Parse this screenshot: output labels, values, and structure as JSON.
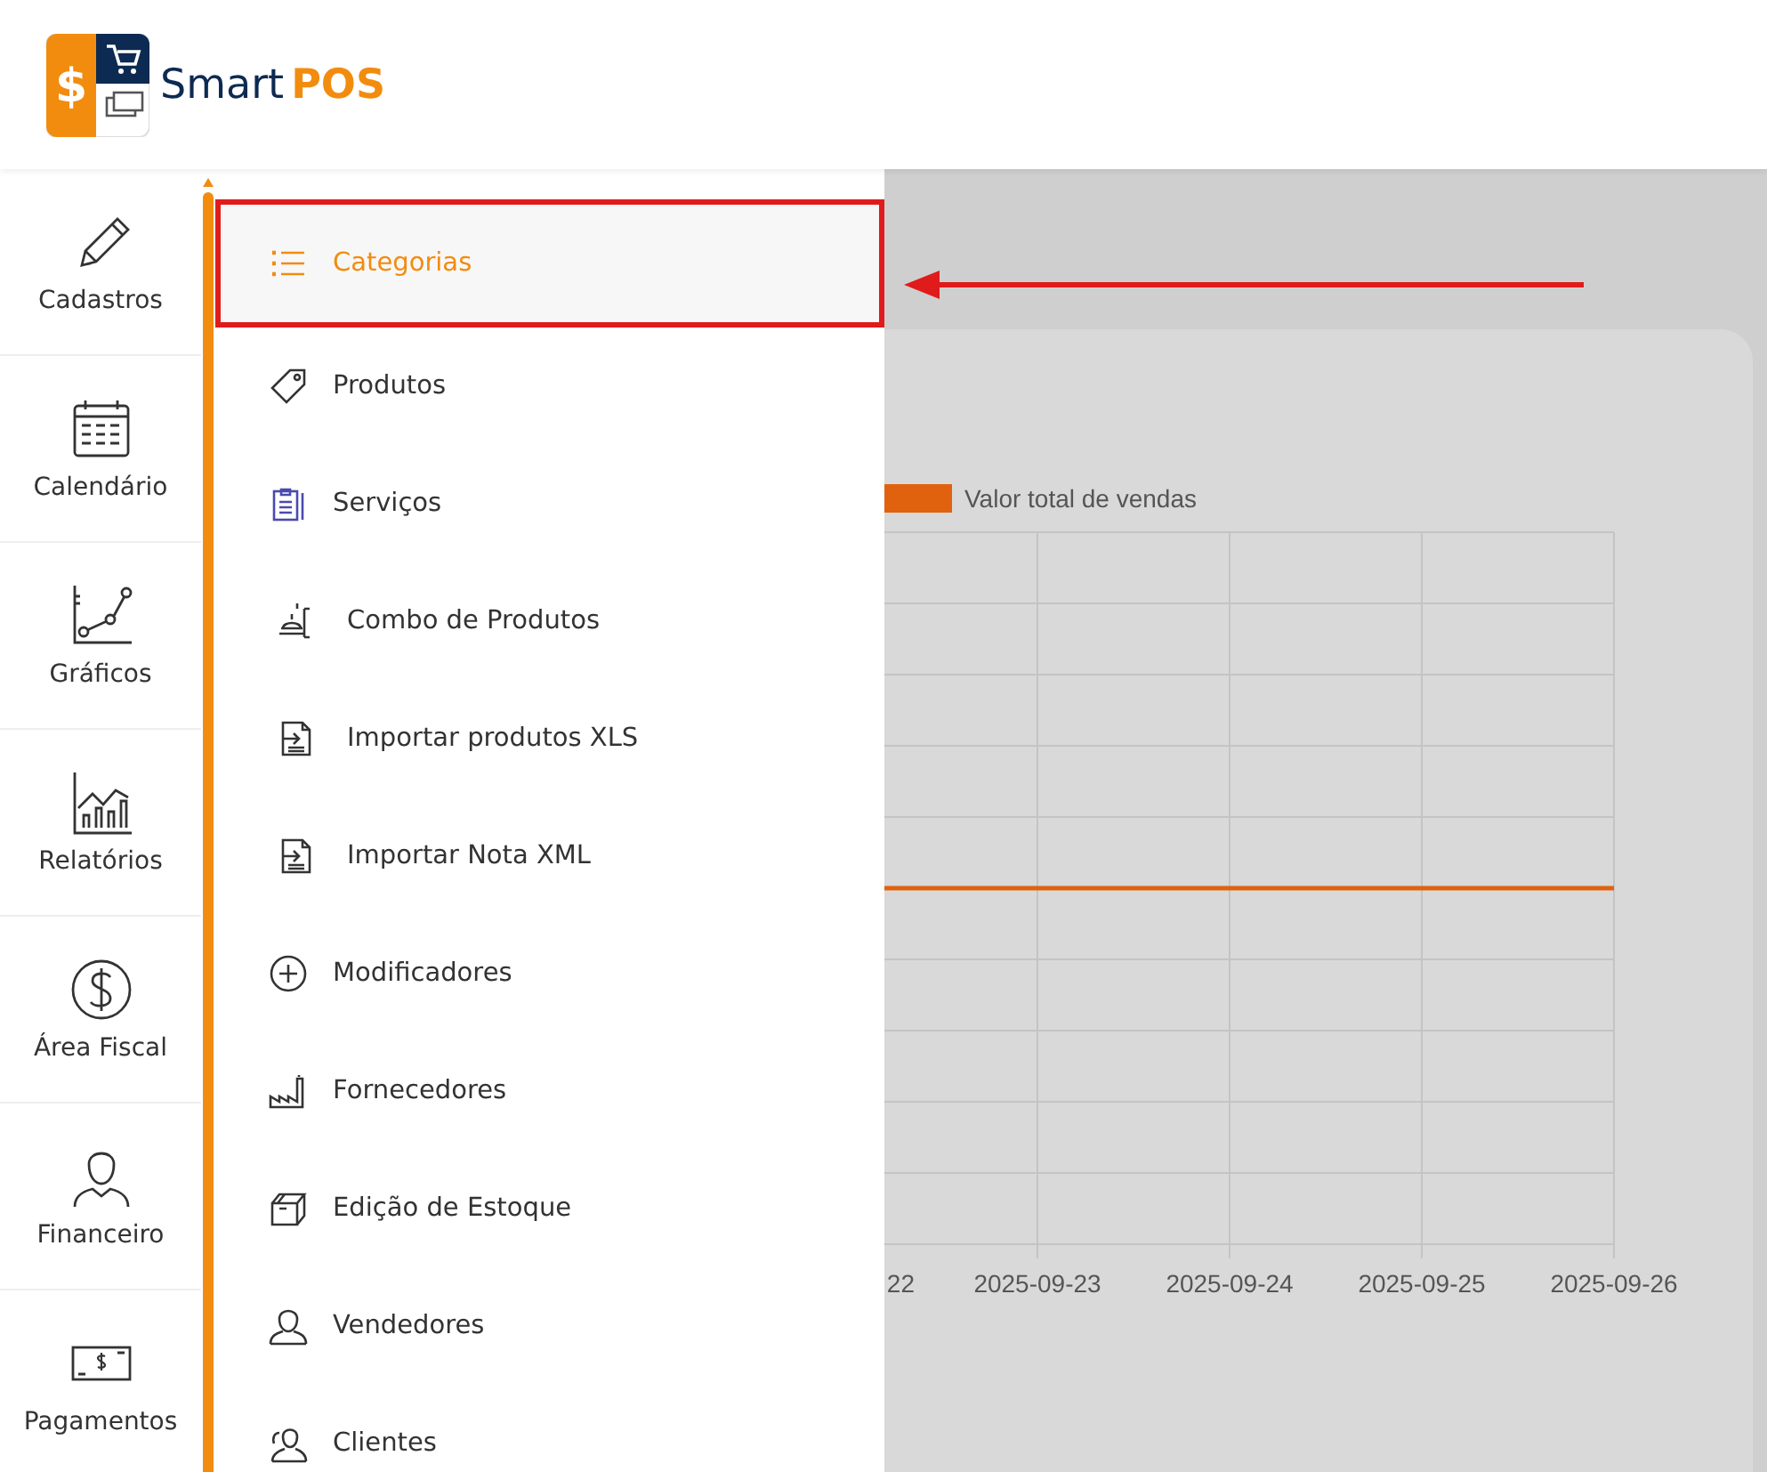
{
  "logo": {
    "mark": "$",
    "name_first": "Smart",
    "name_second": "POS"
  },
  "sidebar": {
    "items": [
      {
        "label": "Cadastros"
      },
      {
        "label": "Calendário"
      },
      {
        "label": "Gráficos"
      },
      {
        "label": "Relatórios"
      },
      {
        "label": "Área Fiscal"
      },
      {
        "label": "Financeiro"
      },
      {
        "label": "Pagamentos"
      }
    ]
  },
  "submenu": {
    "items": [
      {
        "label": "Categorias",
        "selected": true
      },
      {
        "label": "Produtos",
        "selected": false
      },
      {
        "label": "Serviços",
        "selected": false
      },
      {
        "label": "Combo de Produtos",
        "selected": false
      },
      {
        "label": "Importar produtos XLS",
        "selected": false
      },
      {
        "label": "Importar Nota XML",
        "selected": false
      },
      {
        "label": "Modificadores",
        "selected": false
      },
      {
        "label": "Fornecedores",
        "selected": false
      },
      {
        "label": "Edição de Estoque",
        "selected": false
      },
      {
        "label": "Vendedores",
        "selected": false
      },
      {
        "label": "Clientes",
        "selected": false
      }
    ]
  },
  "background_chart": {
    "legend": "Valor total de vendas",
    "x_labels": [
      "22",
      "2025-09-23",
      "2025-09-24",
      "2025-09-25",
      "2025-09-26"
    ]
  },
  "annotations": {
    "frame_around_selected": true,
    "arrow_to_selected": true
  }
}
